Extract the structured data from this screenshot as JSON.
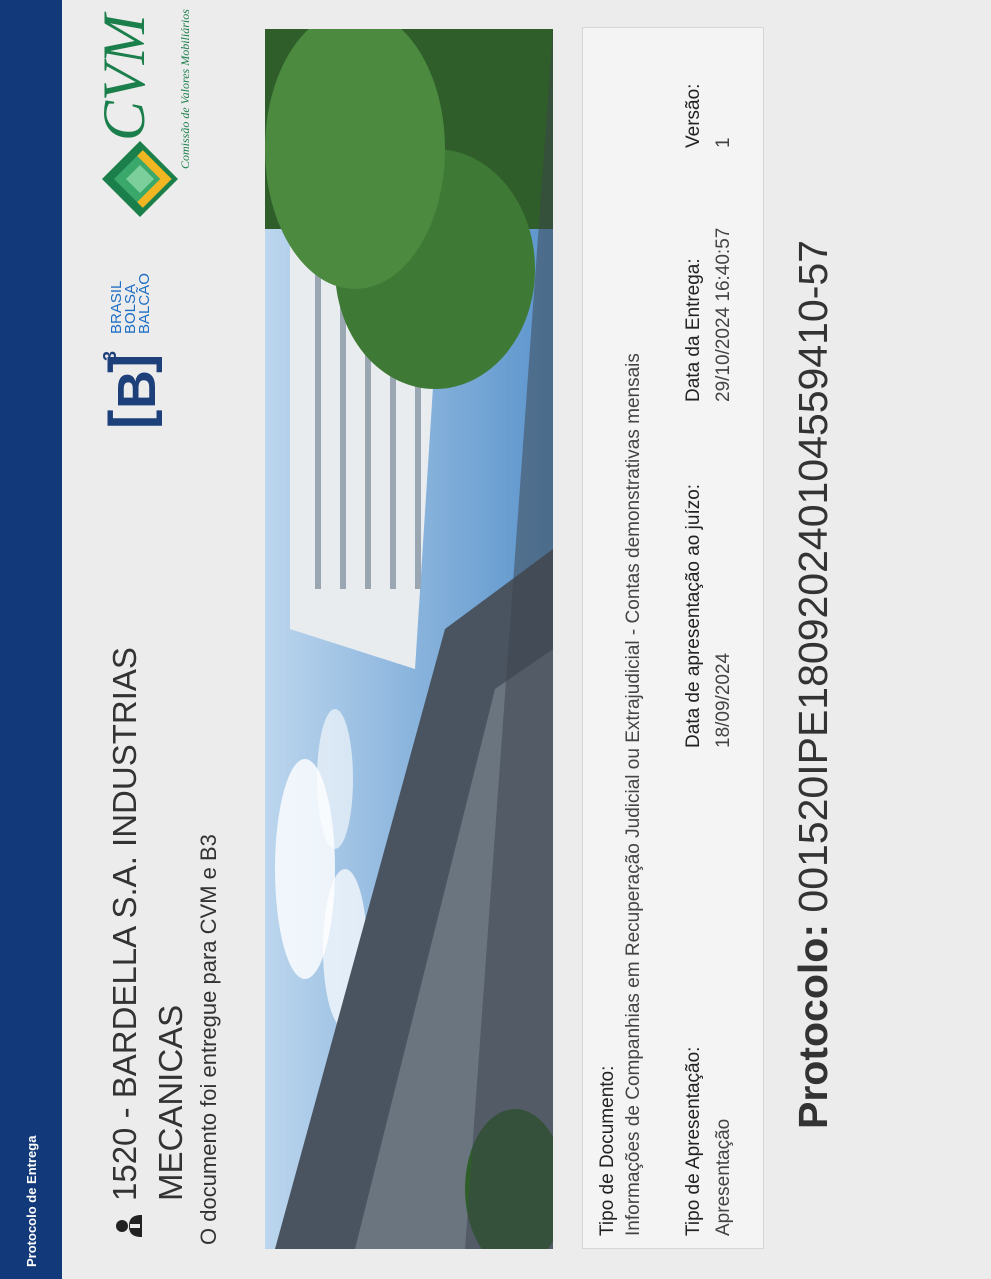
{
  "topbar": {
    "title": "Protocolo de Entrega"
  },
  "header": {
    "company_name": "1520 - BARDELLA S.A. INDUSTRIAS MECANICAS",
    "sent_note": "O documento foi entregue para CVM e B3"
  },
  "logos": {
    "b3": {
      "letter": "B",
      "superscript": "3",
      "words": [
        "BRASIL",
        "BOLSA",
        "BALCÃO"
      ]
    },
    "cvm": {
      "name": "CVM",
      "subtitle": "Comissão de Valores Mobiliários"
    }
  },
  "document": {
    "type_label": "Tipo de Documento:",
    "type_value": "Informações de Companhias em Recuperação Judicial ou Extrajudicial - Contas demonstrativas mensais",
    "presentation_type_label": "Tipo de Apresentação:",
    "presentation_type_value": "Apresentação",
    "court_date_label": "Data de apresentação ao juízo:",
    "court_date_value": "18/09/2024",
    "delivery_date_label": "Data da Entrega:",
    "delivery_date_value": "29/10/2024 16:40:57",
    "version_label": "Versão:",
    "version_value": "1"
  },
  "protocol": {
    "label": "Protocolo:",
    "number": "001520IPE180920240104559410-57"
  },
  "colors": {
    "topbar": "#123a7a",
    "b3_blue": "#1d3f7a",
    "cvm_green": "#1a7f4a"
  }
}
